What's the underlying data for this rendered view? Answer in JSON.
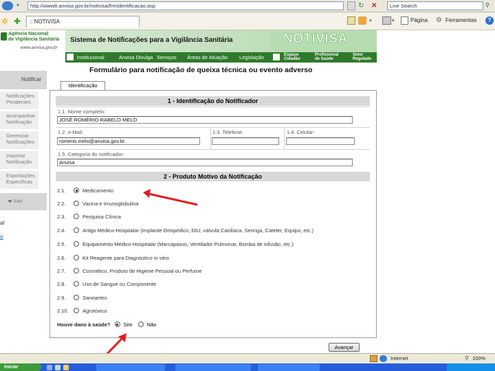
{
  "browser": {
    "address": "http://www8.anvisa.gov.br/notivisa/frmIdentificacao.asp",
    "search_placeholder": "Live Search",
    "tab_title": ":: NOTIVISA",
    "toolbar": {
      "page_label": "Página",
      "tools_label": "Ferramentas"
    }
  },
  "header": {
    "agency_line1": "Agência Nacional",
    "agency_line2": "de Vigilância Sanitária",
    "agency_url": "www.anvisa.gov.br",
    "system_title": "Sistema de Notificações para a Vigilância Sanitária",
    "brand": "NOTIVISA",
    "nav": [
      "Institucional",
      "Anvisa Divulga",
      "Serviços",
      "Áreas de Atuação",
      "Legislação"
    ],
    "right_links": [
      {
        "line1": "Espaço",
        "line2": "Cidadão"
      },
      {
        "line1": "Profissional",
        "line2": "de Saúde"
      },
      {
        "line1": "Setor",
        "line2": "Regulado"
      }
    ]
  },
  "sidebar": {
    "items": [
      {
        "label": "Notificar"
      },
      {
        "label": "Notificações Pendentes"
      },
      {
        "label": "Acompanhar Notificação"
      },
      {
        "label": "Gerenciar Notificações"
      },
      {
        "label": "Importar Notificação"
      },
      {
        "label": "Exportações Específicas"
      },
      {
        "label": "Sair"
      }
    ],
    "cut_text_1": "al",
    "cut_text_2": "o"
  },
  "form": {
    "page_title": "Formulário para notificação de queixa técnica ou evento adverso",
    "tab": "Identificação",
    "section1": "1 - Identificação do Notificador",
    "fields": {
      "name_label": "1.1. Nome completo:",
      "name_value": "JOSÉ ROMÉRIO RABELO MELO",
      "email_label": "1.2. e-Mail:",
      "email_value": "romerio.melo@anvisa.gov.br",
      "phone_label": "1.3. Telefone:",
      "mobile_label": "1.4. Celular:",
      "category_label": "1.5. Categoria do notificador:",
      "category_value": "Anvisa"
    },
    "section2": "2 - Produto Motivo da Notificação",
    "options": [
      {
        "num": "2.1.",
        "label": "Medicamento",
        "checked": true
      },
      {
        "num": "2.2.",
        "label": "Vacina e Imunoglobulina",
        "checked": false
      },
      {
        "num": "2.3.",
        "label": "Pesquisa Clínica",
        "checked": false
      },
      {
        "num": "2.4.",
        "label": "Artigo Médico-Hospitalar (Implante Ortopédico, DIU, válvula Cardíaca, Seringa, Cateter, Equipo, etc.)",
        "checked": false
      },
      {
        "num": "2.5.",
        "label": "Equipamento Médico-Hospitalar (Marcapasso, Ventilador Pulmonar, Bomba de infusão, etc.)",
        "checked": false
      },
      {
        "num": "2.6.",
        "label": "Kit Reagente para Diagnóstico in vitro",
        "checked": false
      },
      {
        "num": "2.7.",
        "label": "Cosmético, Produto de Higiene Pessoal ou Perfume",
        "checked": false
      },
      {
        "num": "2.8.",
        "label": "Uso de Sangue ou Componente",
        "checked": false
      },
      {
        "num": "2.9.",
        "label": "Saneantes",
        "checked": false
      },
      {
        "num": "2.10.",
        "label": "Agrotóxico",
        "checked": false
      }
    ],
    "harm_question": "Houve dano à saúde?",
    "harm_yes": "Sim",
    "harm_no": "Não",
    "advance_button": "Avançar"
  },
  "status": {
    "zone": "Internet",
    "zoom": "100%"
  },
  "taskbar": {
    "start": "Iniciar"
  },
  "colors": {
    "brand_green": "#2f7a2a",
    "arrow_red": "#e31c1c"
  }
}
